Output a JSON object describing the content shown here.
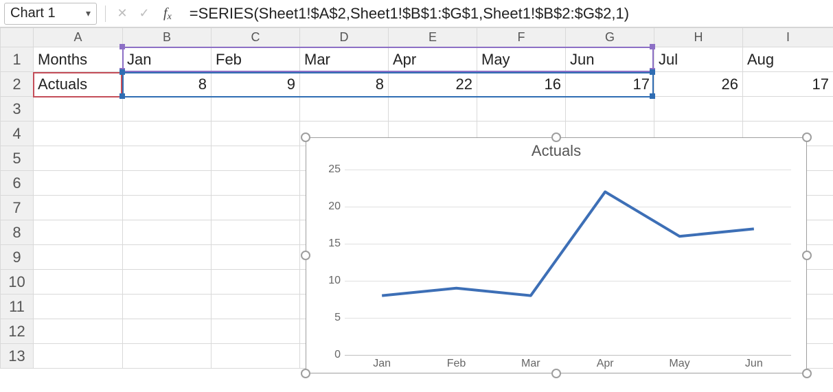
{
  "namebox": {
    "value": "Chart 1"
  },
  "formula_bar": {
    "value": "=SERIES(Sheet1!$A$2,Sheet1!$B$1:$G$1,Sheet1!$B$2:$G$2,1)"
  },
  "columns": [
    "A",
    "B",
    "C",
    "D",
    "E",
    "F",
    "G",
    "H",
    "I"
  ],
  "row1": {
    "A": "Months",
    "B": "Jan",
    "C": "Feb",
    "D": "Mar",
    "E": "Apr",
    "F": "May",
    "G": "Jun",
    "H": "Jul",
    "I": "Aug"
  },
  "row2": {
    "A": "Actuals",
    "B": "8",
    "C": "9",
    "D": "8",
    "E": "22",
    "F": "16",
    "G": "17",
    "H": "26",
    "I": "17"
  },
  "chart": {
    "title": "Actuals"
  },
  "chart_data": {
    "type": "line",
    "title": "Actuals",
    "xlabel": "",
    "ylabel": "",
    "ylim": [
      0,
      25
    ],
    "yticks": [
      0,
      5,
      10,
      15,
      20,
      25
    ],
    "categories": [
      "Jan",
      "Feb",
      "Mar",
      "Apr",
      "May",
      "Jun"
    ],
    "series": [
      {
        "name": "Actuals",
        "values": [
          8,
          9,
          8,
          22,
          16,
          17
        ],
        "color": "#3d6fb6"
      }
    ],
    "grid": true,
    "legend": false
  }
}
